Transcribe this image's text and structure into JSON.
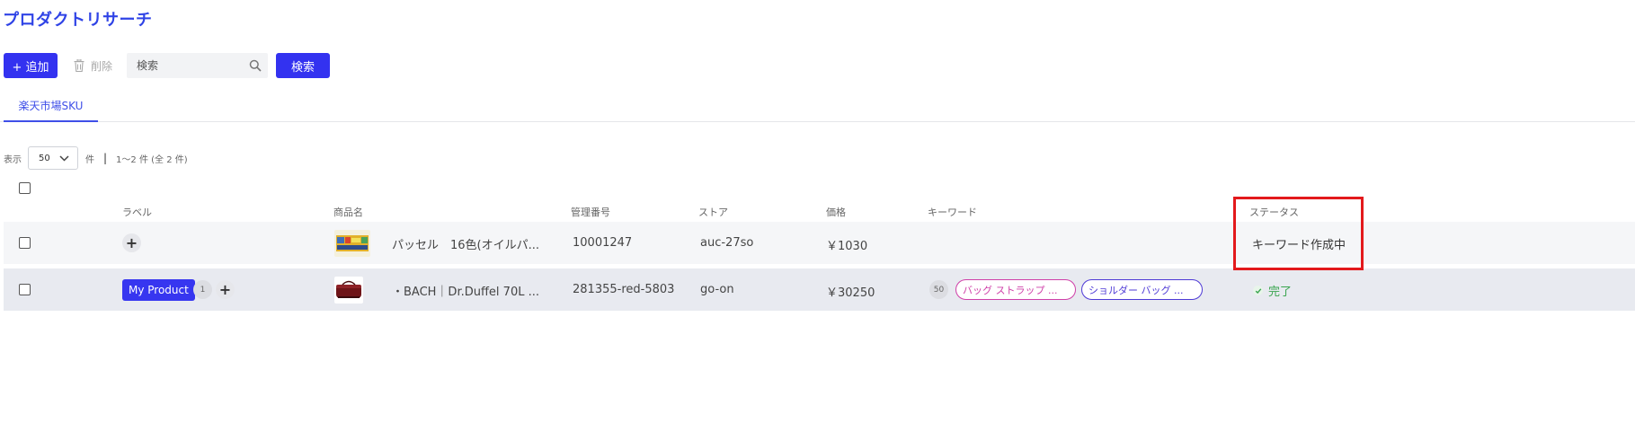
{
  "page": {
    "title": "プロダクトリサーチ"
  },
  "toolbar": {
    "add_label": "+ 追加",
    "delete_label": "削除",
    "search_placeholder": "検索",
    "search_button": "検索"
  },
  "tabs": [
    {
      "label": "楽天市場SKU",
      "active": true
    }
  ],
  "pagination": {
    "show_label": "表示",
    "page_size": "50",
    "unit": "件",
    "separator": "|",
    "range": "1〜2 件 (全 2 件)"
  },
  "table": {
    "headers": {
      "label": "ラベル",
      "product_name": "商品名",
      "management_no": "管理番号",
      "store": "ストア",
      "price": "価格",
      "keyword": "キーワード",
      "status": "ステータス"
    },
    "rows": [
      {
        "label": "",
        "label_count": "",
        "product_name": "パッセル　16色(オイルパ...",
        "management_no": "10001247",
        "store": "auc-27so",
        "price": "￥1030",
        "keyword_count": "",
        "keywords": [],
        "status": "キーワード作成中"
      },
      {
        "label": "My Product",
        "label_count": "1",
        "product_name": "・BACH｜Dr.Duffel 70L ...",
        "management_no": "281355-red-5803",
        "store": "go-on",
        "price": "￥30250",
        "keyword_count": "50",
        "keywords": [
          "バッグ ストラップ ...",
          "ショルダー バッグ ..."
        ],
        "status": "完了"
      }
    ]
  },
  "colors": {
    "accent": "#3332f0",
    "title": "#2f43e6",
    "status_done": "#3aa54f",
    "highlight": "#e3191c",
    "keyword_pink": "#cf3fa8",
    "keyword_blue": "#4e3ad6"
  }
}
